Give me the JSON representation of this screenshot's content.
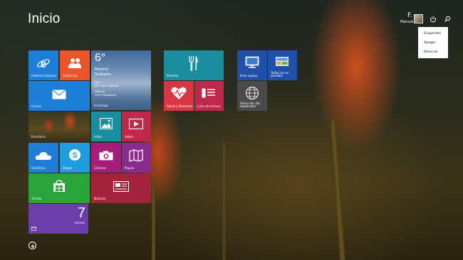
{
  "title": "Inicio",
  "user": {
    "initial": "F.",
    "name": "Manuel"
  },
  "power_menu": [
    "Suspender",
    "Apagar",
    "Reiniciar"
  ],
  "tiles": {
    "ie": "Internet Explorer",
    "contacts": "Contactos",
    "weather": {
      "temp": "6°",
      "city": "Madrid",
      "cond": "Nublado",
      "today_label": "Hoy",
      "today": "9/0° Parc. nublado",
      "tomorrow_label": "Mañana",
      "tomorrow": "10/3° Despejado",
      "name": "El tiempo"
    },
    "mail": "Correo",
    "desktop": "Escritorio",
    "photos": "Fotos",
    "video": "Vídeo",
    "onedrive": "OneDrive",
    "skype": "Skype",
    "camera": "Cámara",
    "maps": "Mapas",
    "store": "Tienda",
    "news": "Noticias",
    "calendar": {
      "day": "7",
      "weekday": "viernes"
    },
    "recipes": "Recetas",
    "health": "Salud y Bienestar",
    "reading": "Lista de lectura",
    "thispc": "Este equipo",
    "control": "Todas las en pantalla",
    "defaults": "Selección del explorador"
  },
  "colors": {
    "blue": "#1c7ed6",
    "orange": "#e9552b",
    "teal": "#1a8e9e",
    "red": "#d73642",
    "crimson": "#c0284a",
    "purple": "#6a3dab",
    "green": "#2aa33b",
    "magenta": "#a61c7b",
    "skyblue": "#1e9de0",
    "darkred": "#a3233a",
    "darkblue": "#1f4fa8",
    "gray": "#4a4a4a"
  }
}
